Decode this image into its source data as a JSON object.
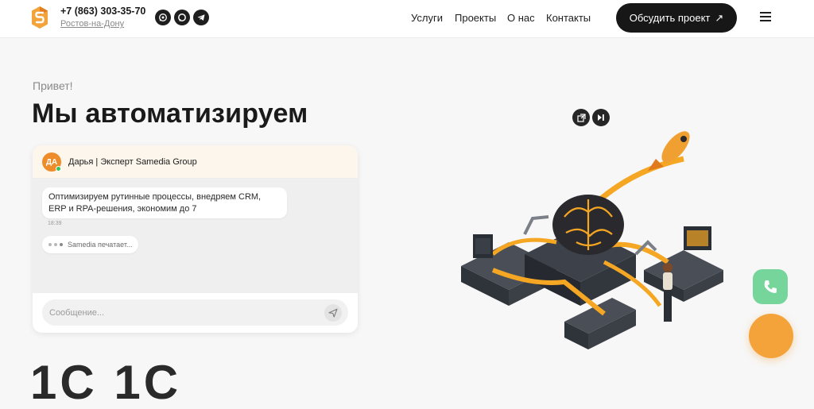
{
  "header": {
    "phone": "+7 (863) 303-35-70",
    "city": "Ростов-на-Дону",
    "social": [
      "whatsapp-icon",
      "max-icon",
      "telegram-icon"
    ],
    "nav": [
      "Услуги",
      "Проекты",
      "О нас",
      "Контакты"
    ],
    "cta": "Обсудить проект",
    "cta_arrow": "↗"
  },
  "hero": {
    "greeting": "Привет!",
    "headline": "Мы автоматизируем"
  },
  "chat": {
    "avatar_initials": "ДА",
    "agent": "Дарья | Эксперт Samedia Group",
    "message": "Оптимизируем рутинные процессы, внедряем CRM, ERP и RPA-решения, экономим до 7",
    "time": "18:39",
    "typing": "Samedia печатает...",
    "input_placeholder": "Сообщение..."
  },
  "below_fold": "1С 1С",
  "colors": {
    "accent": "#f4a33b",
    "dark": "#171717",
    "call": "#5fd08a"
  }
}
